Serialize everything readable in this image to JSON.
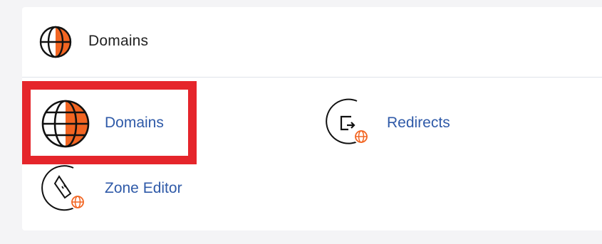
{
  "header": {
    "title": "Domains",
    "icon": "globe-icon"
  },
  "tools": [
    {
      "label": "Domains",
      "icon": "globe-icon"
    },
    {
      "label": "Redirects",
      "icon": "redirect-icon"
    },
    {
      "label": "Zone Editor",
      "icon": "zone-editor-icon"
    }
  ],
  "colors": {
    "accent_orange": "#f26522",
    "link_blue": "#2f5aa8",
    "highlight_red": "#e5252b"
  }
}
